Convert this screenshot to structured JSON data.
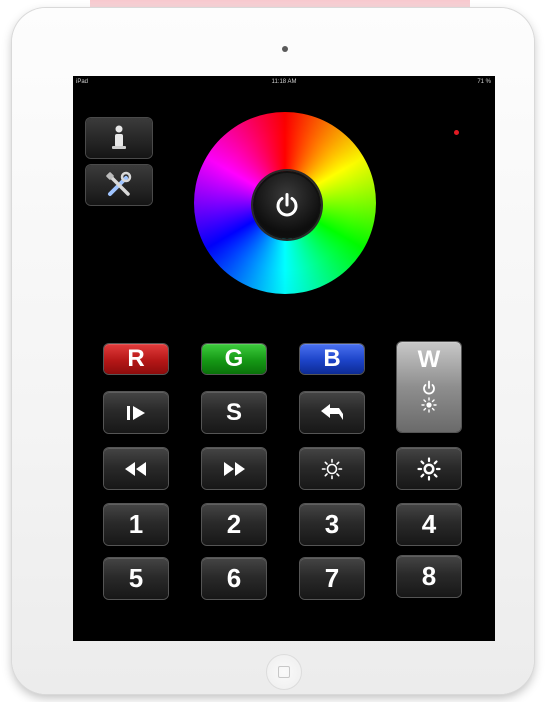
{
  "status_bar": {
    "carrier": "iPad",
    "time": "11:18 AM",
    "battery": "71 %"
  },
  "side_buttons": [
    {
      "icon": "person-info-icon"
    },
    {
      "icon": "tools-icon"
    }
  ],
  "color_wheel": {
    "center_icon": "power-icon"
  },
  "rows": {
    "color_keys": {
      "r": "R",
      "g": "G",
      "b": "B",
      "w": "W"
    },
    "mode_keys": {
      "s": "S"
    },
    "numbers": [
      "1",
      "2",
      "3",
      "4",
      "5",
      "6",
      "7",
      "8"
    ]
  },
  "colors": {
    "red": "#b51717",
    "green": "#159815",
    "blue": "#1c43c8",
    "white_key": "#8e8e8e",
    "led": "#e21b23"
  }
}
